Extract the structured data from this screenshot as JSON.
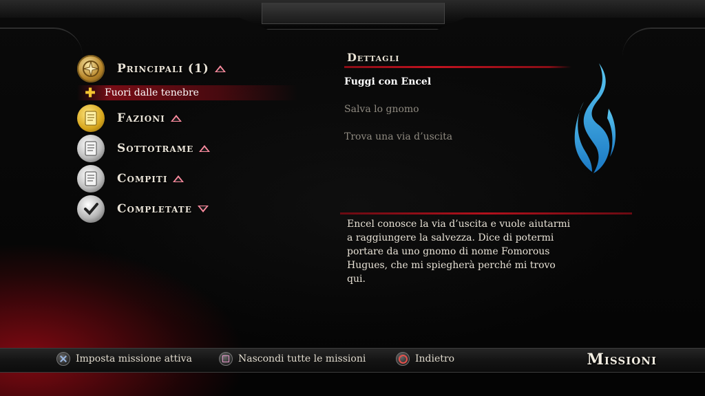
{
  "menu": {
    "items": [
      {
        "label": "Principali (1)",
        "icon": "compass-medallion-icon",
        "arrow": "up"
      },
      {
        "label": "Fazioni",
        "icon": "gold-scroll-icon",
        "arrow": "up"
      },
      {
        "label": "Sottotrame",
        "icon": "silver-scroll-icon",
        "arrow": "up"
      },
      {
        "label": "Compiti",
        "icon": "silver-scroll-icon",
        "arrow": "up"
      },
      {
        "label": "Completate",
        "icon": "checkmark-icon",
        "arrow": "down"
      }
    ],
    "selected_quest": "Fuori dalle tenebre"
  },
  "details": {
    "title": "Dettagli",
    "objectives": [
      {
        "text": "Fuggi con Encel",
        "state": "active"
      },
      {
        "text": "Salva lo gnomo",
        "state": "inactive"
      },
      {
        "text": "Trova una via d’uscita",
        "state": "inactive"
      }
    ],
    "emblem_icon": "blue-flame-emblem-icon",
    "description": "Encel conosce la via d’uscita e vuole aiutarmi\na raggiungere la salvezza. Dice di potermi\nportare da uno gnomo di nome Fomorous\nHugues, che mi spiegherà perché mi trovo\nqui."
  },
  "bottom": {
    "hints": [
      {
        "button": "cross-button-icon",
        "label": "Imposta missione attiva"
      },
      {
        "button": "square-button-icon",
        "label": "Nascondi tutte le missioni"
      },
      {
        "button": "circle-button-icon",
        "label": "Indietro"
      }
    ],
    "screen_title": "Missioni"
  },
  "colors": {
    "accent_red": "#c2121f",
    "arrow_pink": "#ff8ca0",
    "emblem_blue": "#2a9ad8",
    "gold": "#f4c430"
  }
}
